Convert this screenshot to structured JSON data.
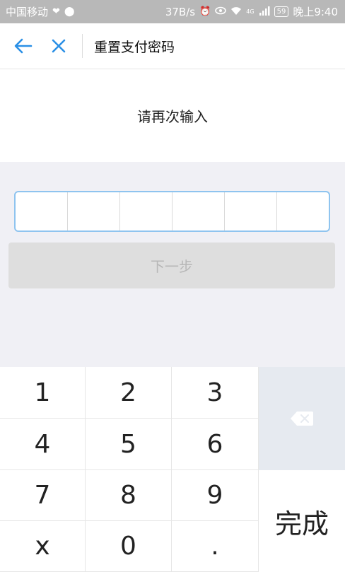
{
  "status_bar": {
    "carrier": "中国移动",
    "speed": "37B/s",
    "network": "4G",
    "battery": "59",
    "time": "晚上9:40"
  },
  "nav": {
    "title": "重置支付密码"
  },
  "prompt": "请再次输入",
  "pin": {
    "length": 6,
    "entered": 0
  },
  "next_label": "下一步",
  "keypad": {
    "keys": [
      "1",
      "2",
      "3",
      "4",
      "5",
      "6",
      "7",
      "8",
      "9",
      "x",
      "0",
      "."
    ],
    "done_label": "完成"
  },
  "colors": {
    "accent": "#2b90e6",
    "status_bar": "#b8b8b8",
    "pin_border": "#8fc4ef",
    "disabled_button": "#dedede",
    "disabled_text": "#b7b7b7",
    "delete_key_bg": "#e6eaf0"
  }
}
